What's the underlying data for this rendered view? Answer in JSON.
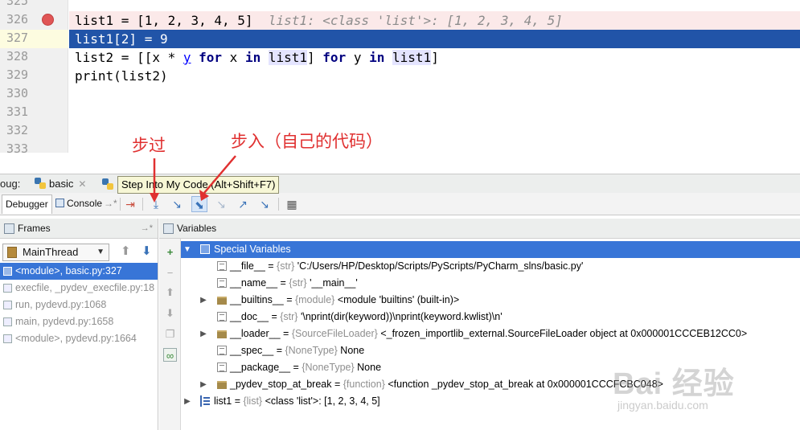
{
  "editor": {
    "lines": [
      {
        "num": "325"
      },
      {
        "num": "326",
        "breakpoint": true
      },
      {
        "num": "327",
        "current": true
      },
      {
        "num": "328"
      },
      {
        "num": "329"
      },
      {
        "num": "330"
      },
      {
        "num": "331"
      },
      {
        "num": "332"
      },
      {
        "num": "333"
      }
    ],
    "code": {
      "l326_code": "list1 = [1, 2, 3, 4, 5]",
      "l326_inline": "list1: <class 'list'>: [1, 2, 3, 4, 5]",
      "l327": "list1[2] = 9",
      "l328_a": "list2 = [[x * ",
      "l328_y": "y",
      "l328_for1": "for",
      "l328_x": " x ",
      "l328_in1": "in",
      "l328_list1a": "list1",
      "l328_mid": "] ",
      "l328_for2": "for",
      "l328_y2": " y ",
      "l328_in2": "in",
      "l328_list1b": "list1",
      "l328_end": "]",
      "l329": "print(list2)"
    }
  },
  "annotations": {
    "step_over": "步过",
    "step_into_my_code": "步入（自己的代码）"
  },
  "debug_bar": {
    "label": "oug:",
    "run_tab": "basic",
    "debugger_tab": "Debugger",
    "console_tab": "Console",
    "console_suffix": "→*",
    "tooltip": "Step Into My Code (Alt+Shift+F7)"
  },
  "frames_panel": {
    "title": "Frames",
    "pin": "→*",
    "thread": "MainThread",
    "rows": [
      {
        "label": "<module>, basic.py:327",
        "selected": true
      },
      {
        "label": "execfile, _pydev_execfile.py:18"
      },
      {
        "label": "run, pydevd.py:1068"
      },
      {
        "label": "main, pydevd.py:1658"
      },
      {
        "label": "<module>, pydevd.py:1664"
      }
    ]
  },
  "variables_panel": {
    "title": "Variables",
    "rows": [
      {
        "name": "Special Variables",
        "type": "",
        "value": "",
        "level": 0,
        "expandable": true,
        "expanded": true,
        "selected": true,
        "icon": "special-icon"
      },
      {
        "name": "__file__",
        "type": "{str}",
        "value": "'C:/Users/HP/Desktop/Scripts/PyScripts/PyCharm_slns/basic.py'",
        "level": 1,
        "icon": "str-icon"
      },
      {
        "name": "__name__",
        "type": "{str}",
        "value": "'__main__'",
        "level": 1,
        "icon": "str-icon"
      },
      {
        "name": "__builtins__",
        "type": "{module}",
        "value": "<module 'builtins' (built-in)>",
        "level": 1,
        "expandable": true,
        "icon": "object-icon"
      },
      {
        "name": "__doc__",
        "type": "{str}",
        "value": "'\\nprint(dir(keyword))\\nprint(keyword.kwlist)\\n'",
        "level": 1,
        "icon": "str-icon"
      },
      {
        "name": "__loader__",
        "type": "{SourceFileLoader}",
        "value": "<_frozen_importlib_external.SourceFileLoader object at 0x000001CCCEB12CC0>",
        "level": 1,
        "expandable": true,
        "icon": "object-icon"
      },
      {
        "name": "__spec__",
        "type": "{NoneType}",
        "value": "None",
        "level": 1,
        "icon": "str-icon"
      },
      {
        "name": "__package__",
        "type": "{NoneType}",
        "value": "None",
        "level": 1,
        "icon": "str-icon"
      },
      {
        "name": "_pydev_stop_at_break",
        "type": "{function}",
        "value": "<function _pydev_stop_at_break at 0x000001CCCFCBC048>",
        "level": 1,
        "expandable": true,
        "icon": "object-icon"
      },
      {
        "name": "list1",
        "type": "{list}",
        "value": "<class 'list'>: [1, 2, 3, 4, 5]",
        "level": 0,
        "expandable": true,
        "icon": "list-icon"
      }
    ]
  },
  "watermark": {
    "logo": "Bai 经验",
    "url": "jingyan.baidu.com"
  },
  "colors": {
    "execution_line": "#2154a8",
    "selection": "#3875d7",
    "annotation": "#e03030"
  }
}
